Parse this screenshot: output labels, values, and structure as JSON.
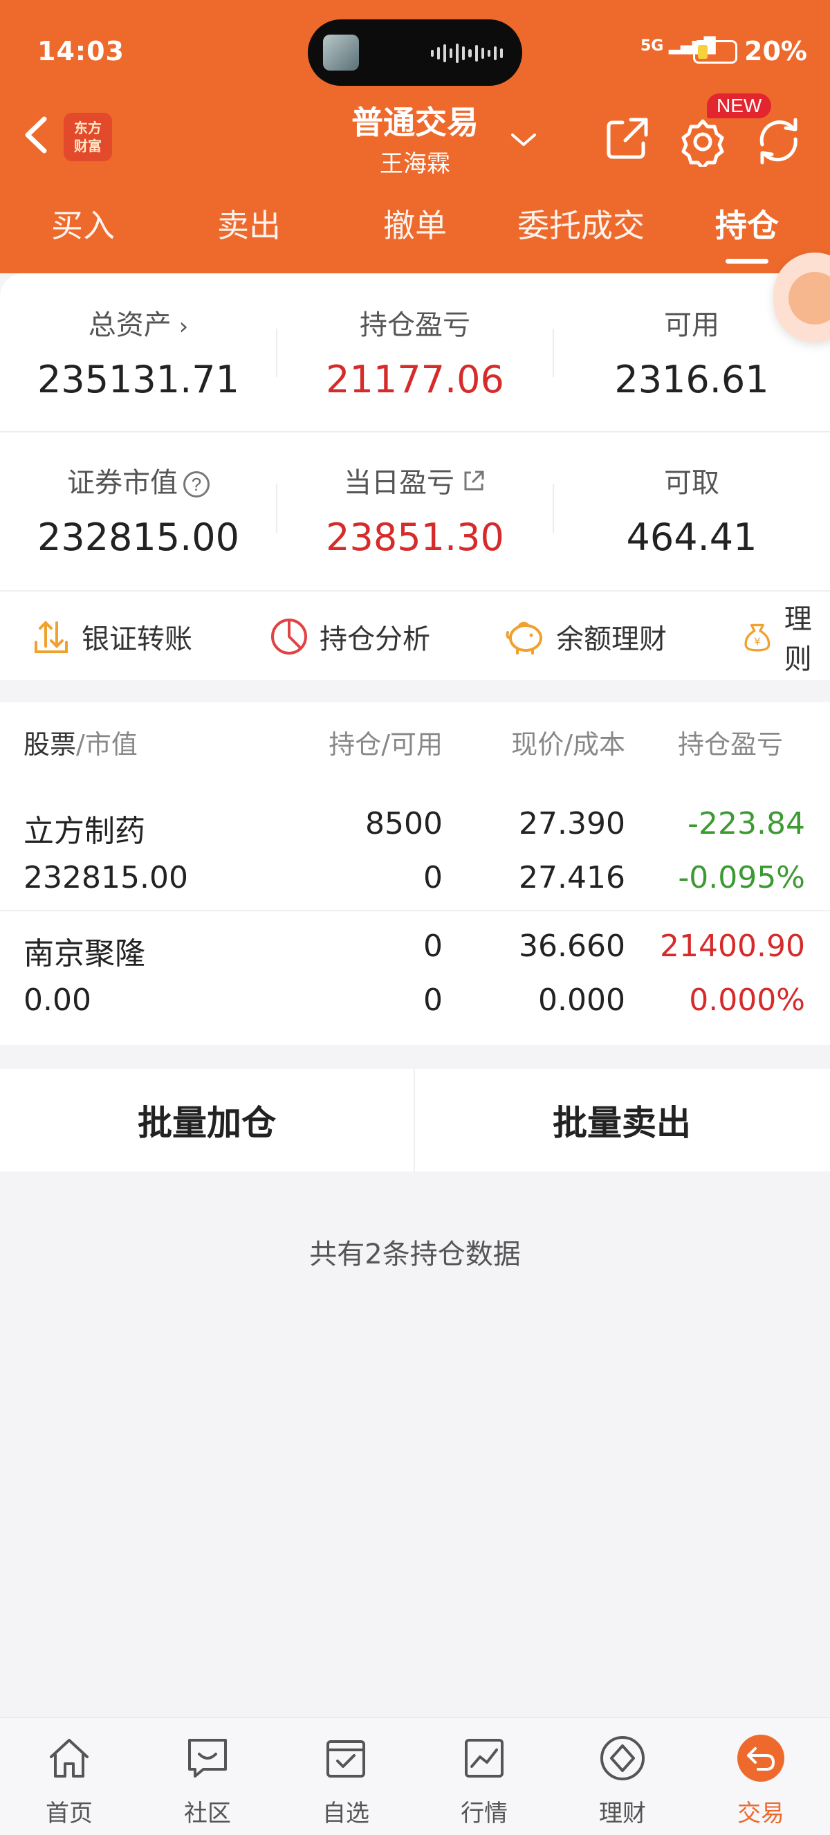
{
  "status_bar": {
    "time": "14:03",
    "network": "5G",
    "battery": "20%"
  },
  "header": {
    "logo_text": "东方财富",
    "title": "普通交易",
    "subtitle": "王海霖",
    "new_badge": "NEW",
    "accent_color": "#ee6a2c"
  },
  "tabs": [
    {
      "label": "买入",
      "active": false
    },
    {
      "label": "卖出",
      "active": false
    },
    {
      "label": "撤单",
      "active": false
    },
    {
      "label": "委托成交",
      "active": false
    },
    {
      "label": "持仓",
      "active": true
    }
  ],
  "summary": {
    "total_assets": {
      "label": "总资产",
      "value": "235131.71"
    },
    "position_pl": {
      "label": "持仓盈亏",
      "value": "21177.06"
    },
    "available": {
      "label": "可用",
      "value": "2316.61"
    },
    "market_value": {
      "label": "证券市值",
      "value": "232815.00"
    },
    "daily_pl": {
      "label": "当日盈亏",
      "value": "23851.30"
    },
    "withdrawable": {
      "label": "可取",
      "value": "464.41"
    }
  },
  "quick_actions": [
    {
      "label": "银证转账",
      "icon": "transfer-icon"
    },
    {
      "label": "持仓分析",
      "icon": "pie-chart-icon"
    },
    {
      "label": "余额理财",
      "icon": "piggy-bank-icon"
    },
    {
      "label": "理则",
      "icon": "money-bag-icon"
    }
  ],
  "table": {
    "headers": {
      "stock": "股票",
      "market_value": "/市值",
      "position": "持仓/可用",
      "price": "现价/成本",
      "pl": "持仓盈亏"
    },
    "rows": [
      {
        "name": "立方制药",
        "market_value": "232815.00",
        "position": "8500",
        "available": "0",
        "price": "27.390",
        "cost": "27.416",
        "pl": "-223.84",
        "pl_pct": "-0.095%"
      },
      {
        "name": "南京聚隆",
        "market_value": "0.00",
        "position": "0",
        "available": "0",
        "price": "36.660",
        "cost": "0.000",
        "pl": "21400.90",
        "pl_pct": "0.000%"
      }
    ]
  },
  "batch": {
    "add_label": "批量加仓",
    "sell_label": "批量卖出"
  },
  "footer_note": "共有2条持仓数据",
  "bottom_nav": [
    {
      "label": "首页",
      "icon": "home-icon"
    },
    {
      "label": "社区",
      "icon": "chat-icon"
    },
    {
      "label": "自选",
      "icon": "watchlist-icon"
    },
    {
      "label": "行情",
      "icon": "market-chart-icon"
    },
    {
      "label": "理财",
      "icon": "wealth-icon"
    },
    {
      "label": "交易",
      "icon": "trade-icon",
      "active": true
    }
  ]
}
